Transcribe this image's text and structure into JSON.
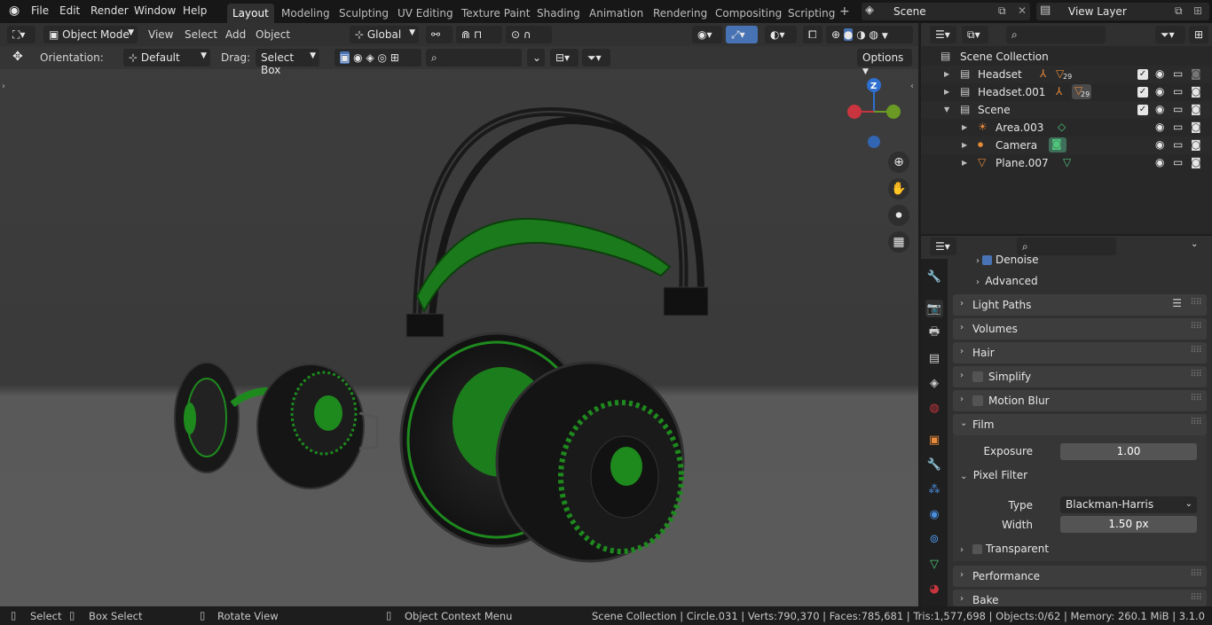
{
  "topbar": {
    "menus": [
      "File",
      "Edit",
      "Render",
      "Window",
      "Help"
    ],
    "workspaces": [
      "Layout",
      "Modeling",
      "Sculpting",
      "UV Editing",
      "Texture Paint",
      "Shading",
      "Animation",
      "Rendering",
      "Compositing",
      "Scripting"
    ],
    "active_workspace": "Layout",
    "scene": "Scene",
    "view_layer": "View Layer"
  },
  "viewport": {
    "mode": "Object Mode",
    "menus": [
      "View",
      "Select",
      "Add",
      "Object"
    ],
    "transform_orientation": "Global",
    "orientation_label": "Orientation:",
    "orientation_value": "Default",
    "drag_label": "Drag:",
    "drag_value": "Select Box",
    "options": "Options",
    "gizmo": {
      "z": "Z"
    }
  },
  "outliner": {
    "root": "Scene Collection",
    "rows": [
      {
        "name": "Headset",
        "badge": "29"
      },
      {
        "name": "Headset.001",
        "badge": "29"
      },
      {
        "name": "Scene"
      },
      {
        "name": "Area.003"
      },
      {
        "name": "Camera"
      },
      {
        "name": "Plane.007"
      }
    ]
  },
  "properties": {
    "panels": {
      "denoise": "Denoise",
      "advanced": "Advanced",
      "light_paths": "Light Paths",
      "volumes": "Volumes",
      "hair": "Hair",
      "simplify": "Simplify",
      "motion_blur": "Motion Blur",
      "film": "Film",
      "pixel_filter": "Pixel Filter",
      "transparent": "Transparent",
      "performance": "Performance",
      "bake": "Bake"
    },
    "film": {
      "exposure_label": "Exposure",
      "exposure_value": "1.00",
      "type_label": "Type",
      "type_value": "Blackman-Harris",
      "width_label": "Width",
      "width_value": "1.50 px"
    }
  },
  "statusbar": {
    "select": "Select",
    "box_select": "Box Select",
    "rotate_view": "Rotate View",
    "context_menu": "Object Context Menu",
    "stats": "Scene Collection | Circle.031 | Verts:790,370 | Faces:785,681 | Tris:1,577,698 | Objects:0/62 | Memory: 260.1 MiB | 3.1.0"
  },
  "colors": {
    "accent_blue": "#4772b3",
    "headset_green": "#1e8a1e",
    "axis_x": "#c8353f",
    "axis_y": "#6a9a23",
    "axis_z": "#2f6fd0"
  }
}
